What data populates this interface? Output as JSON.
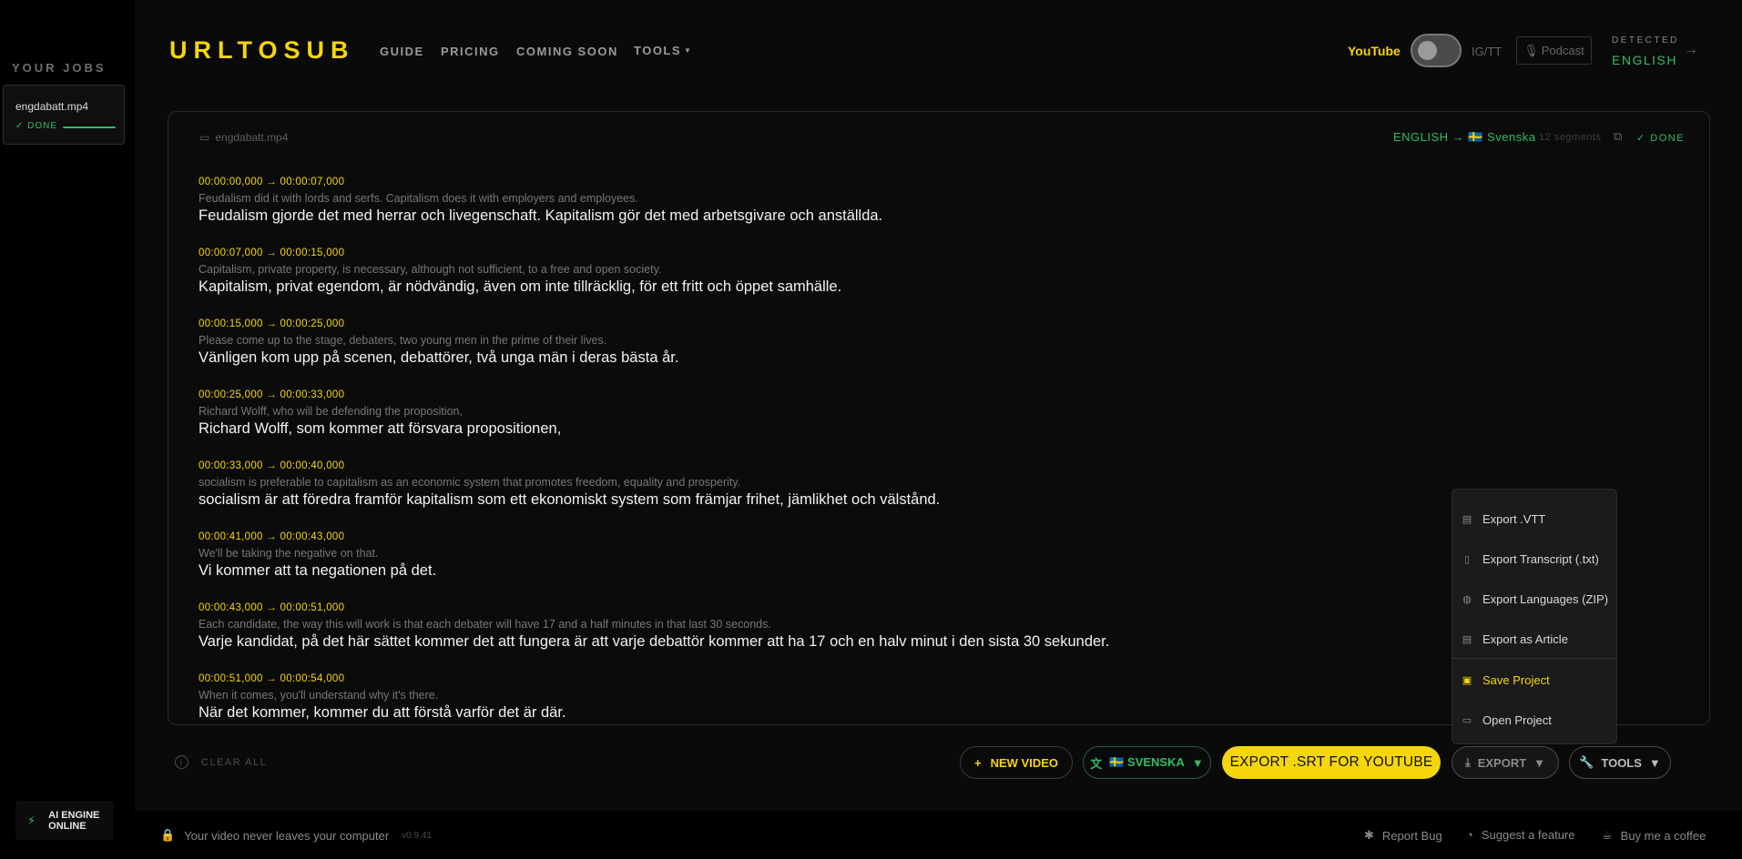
{
  "sidebar": {
    "title": "YOUR JOBS",
    "jobs": [
      {
        "name": "engdabatt.mp4",
        "status": "✓ DONE",
        "progress": 1.0
      }
    ],
    "engine_status": "AI ENGINE ONLINE"
  },
  "header": {
    "logo": "URLTOSUB",
    "nav": [
      "GUIDE",
      "PRICING",
      "COMING SOON",
      "TOOLS"
    ],
    "source_toggle": {
      "left": "YouTube",
      "right": "IG/TT",
      "active": "YouTube"
    },
    "podcast_label": "Podcast",
    "detected_label": "DETECTED",
    "detected_language": "ENGLISH"
  },
  "panel": {
    "file_name": "engdabatt.mp4",
    "language_pair": "ENGLISH → 🇸🇪 Svenska",
    "segment_count": "12 segments",
    "status": "✓ DONE",
    "segments": [
      {
        "time": "00:00:00,000 → 00:00:07,000",
        "source": "Feudalism did it with lords and serfs. Capitalism does it with employers and employees.",
        "target": "Feudalism gjorde det med herrar och livegenschaft. Kapitalism gör det med arbetsgivare och anställda."
      },
      {
        "time": "00:00:07,000 → 00:00:15,000",
        "source": "Capitalism, private property, is necessary, although not sufficient, to a free and open society.",
        "target": "Kapitalism, privat egendom, är nödvändig, även om inte tillräcklig, för ett fritt och öppet samhälle."
      },
      {
        "time": "00:00:15,000 → 00:00:25,000",
        "source": "Please come up to the stage, debaters, two young men in the prime of their lives.",
        "target": "Vänligen kom upp på scenen, debattörer, två unga män i deras bästa år."
      },
      {
        "time": "00:00:25,000 → 00:00:33,000",
        "source": "Richard Wolff, who will be defending the proposition,",
        "target": "Richard Wolff, som kommer att försvara propositionen,"
      },
      {
        "time": "00:00:33,000 → 00:00:40,000",
        "source": "socialism is preferable to capitalism as an economic system that promotes freedom, equality and prosperity.",
        "target": "socialism är att föredra framför kapitalism som ett ekonomiskt system som främjar frihet, jämlikhet och välstånd."
      },
      {
        "time": "00:00:41,000 → 00:00:43,000",
        "source": "We'll be taking the negative on that.",
        "target": "Vi kommer att ta negationen på det."
      },
      {
        "time": "00:00:43,000 → 00:00:51,000",
        "source": "Each candidate, the way this will work is that each debater will have 17 and a half minutes in that last 30 seconds.",
        "target": "Varje kandidat, på det här sättet kommer det att fungera är att varje debattör kommer att ha 17 och en halv minut i den sista 30 sekunder."
      },
      {
        "time": "00:00:51,000 → 00:00:54,000",
        "source": "When it comes, you'll understand why it's there.",
        "target": "När det kommer, kommer du att förstå varför det är där."
      }
    ]
  },
  "actions": {
    "clear_all": "CLEAR ALL",
    "new_video": "NEW VIDEO",
    "language": "🇸🇪 SVENSKA",
    "export_srt": "EXPORT .SRT FOR YOUTUBE",
    "export": "EXPORT",
    "tools": "TOOLS"
  },
  "export_menu": {
    "items": [
      {
        "label": "Export .VTT",
        "icon": "caption-icon"
      },
      {
        "label": "Export Transcript (.txt)",
        "icon": "document-icon"
      },
      {
        "label": "Export Languages (ZIP)",
        "icon": "globe-icon"
      },
      {
        "label": "Export as Article",
        "icon": "article-icon"
      },
      {
        "label": "Save Project",
        "icon": "save-icon",
        "active": true
      },
      {
        "label": "Open Project",
        "icon": "folder-icon"
      }
    ]
  },
  "footer": {
    "privacy": "Your video never leaves your computer",
    "version": "v0.9.41",
    "links": [
      "Report Bug",
      "Suggest a feature",
      "Buy me a coffee"
    ]
  },
  "colors": {
    "accent_yellow": "#f5d60a",
    "accent_green": "#2ebd66",
    "background": "#0a0a0a"
  }
}
